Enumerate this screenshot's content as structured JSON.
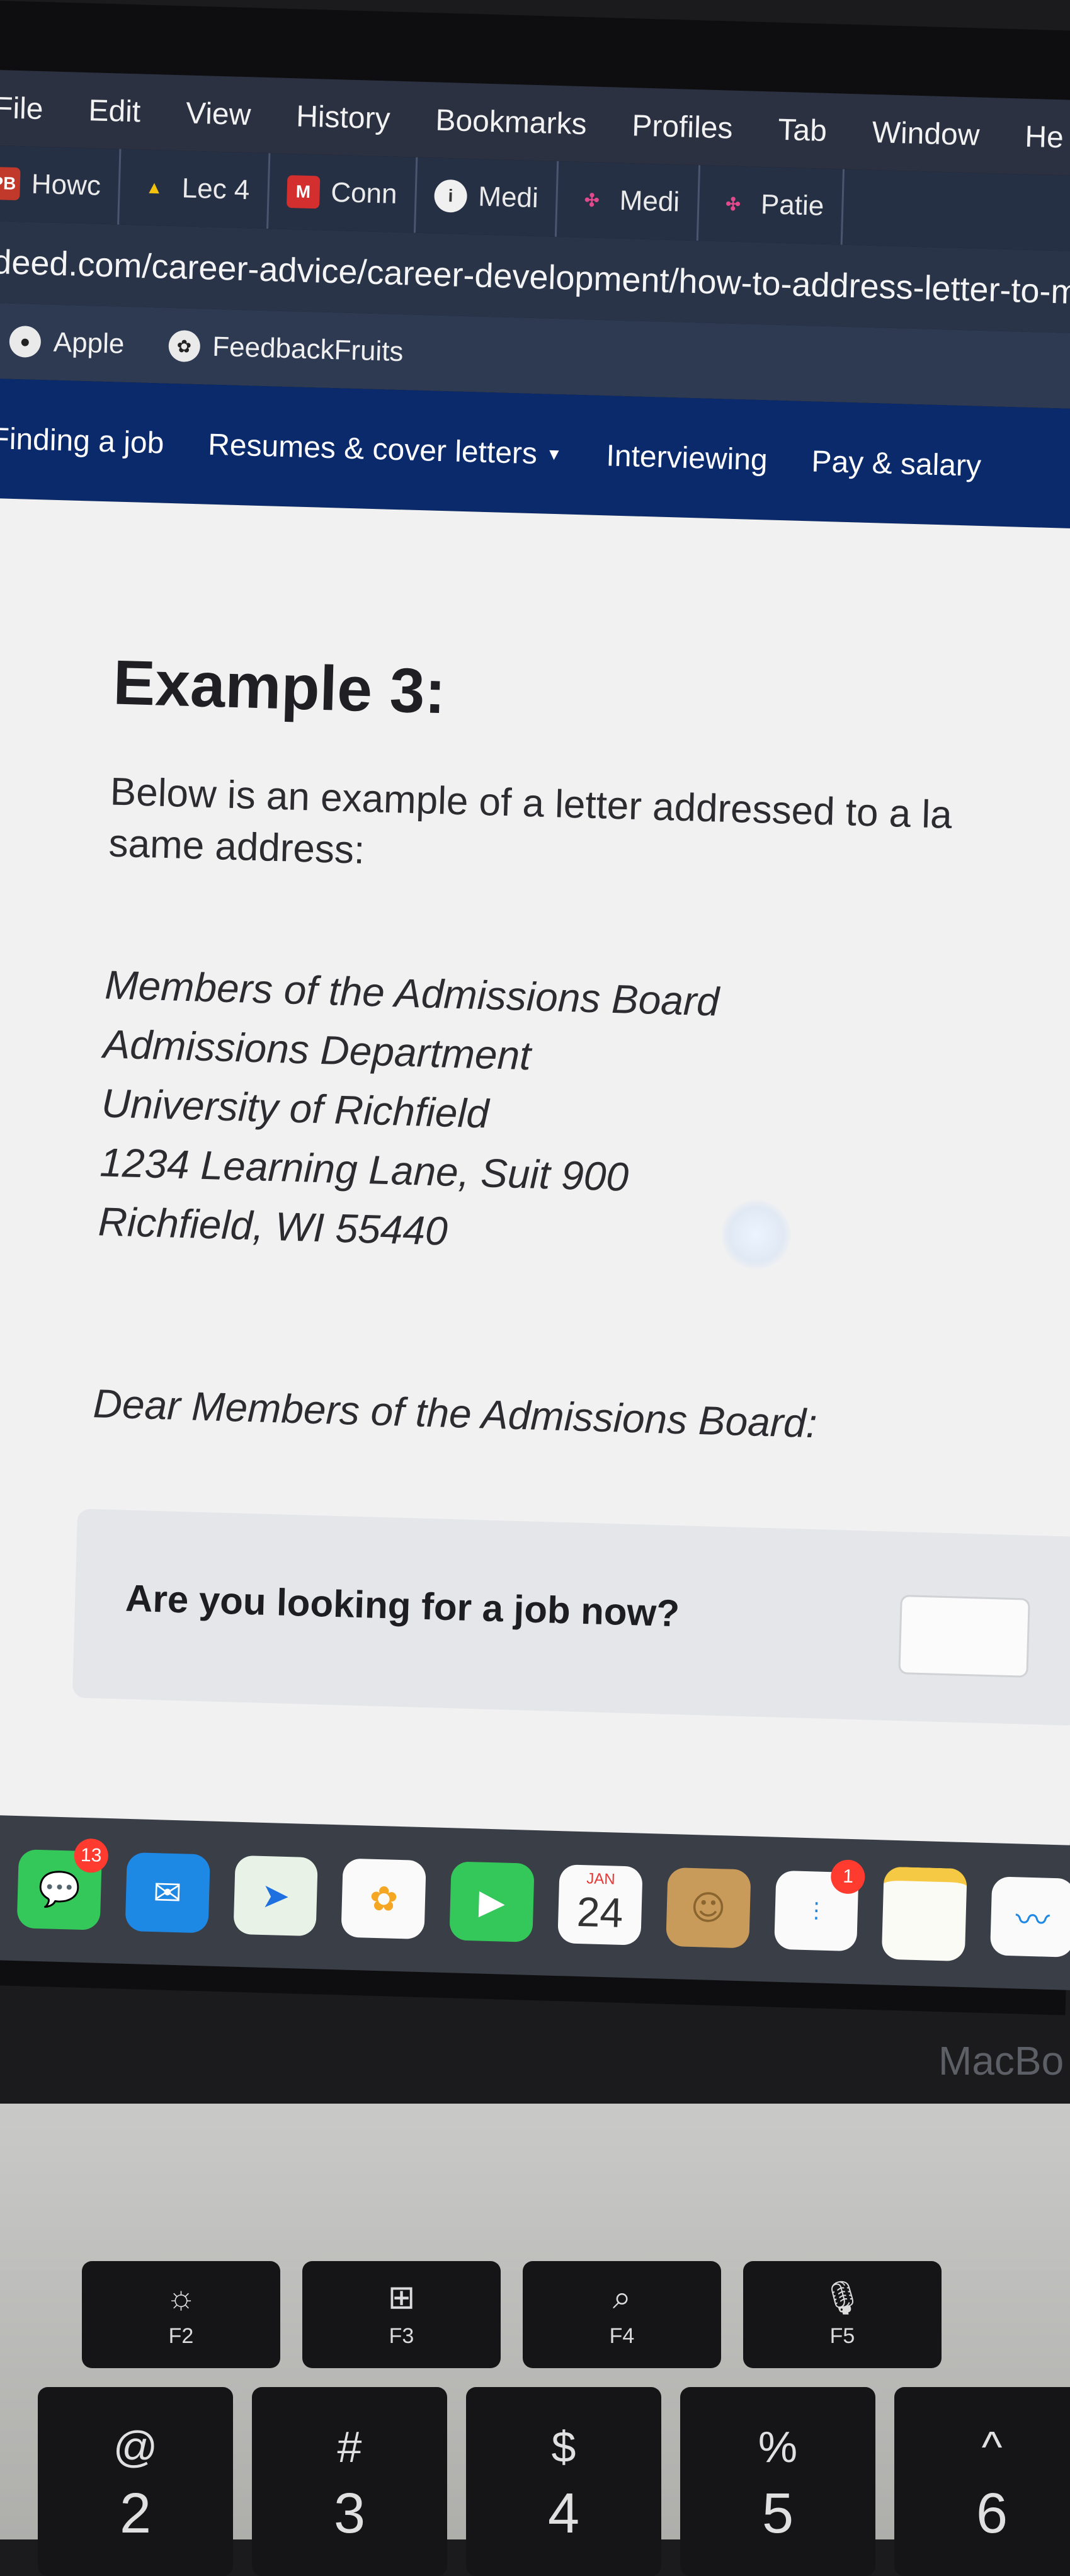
{
  "menubar": {
    "items": [
      "File",
      "Edit",
      "View",
      "History",
      "Bookmarks",
      "Profiles",
      "Tab",
      "Window",
      "He"
    ]
  },
  "tabs": [
    {
      "icon_text": "PB",
      "label": "Howc",
      "icon": "pb-icon",
      "color": "#c0392b"
    },
    {
      "icon_text": "▲",
      "label": "Lec 4",
      "icon": "google-drive-icon",
      "color": "#2b3140"
    },
    {
      "icon_text": "M",
      "label": "Conn",
      "icon": "m-logo-icon",
      "color": "#d32f2f"
    },
    {
      "icon_text": "i",
      "label": "Medi",
      "icon": "info-icon",
      "color": "#2b3140"
    },
    {
      "icon_text": "✣",
      "label": "Medi",
      "icon": "medical-star-icon",
      "color": "#2b3140"
    },
    {
      "icon_text": "✣",
      "label": "Patie",
      "icon": "medical-star-icon",
      "color": "#2b3140"
    }
  ],
  "url": "ndeed.com/career-advice/career-development/how-to-address-letter-to-m",
  "bookmarks": [
    {
      "label": "Apple",
      "icon": "apple-icon"
    },
    {
      "label": "FeedbackFruits",
      "icon": "feedbackfruits-icon"
    }
  ],
  "site_nav": {
    "finding_job": "Finding a job",
    "resumes": "Resumes & cover letters",
    "interviewing": "Interviewing",
    "pay": "Pay & salary"
  },
  "article": {
    "title": "Example 3:",
    "intro": "Below is an example of a letter addressed to a la same address:",
    "address_lines": [
      "Members of the Admissions Board",
      "Admissions Department",
      "University of Richfield",
      "1234 Learning Lane, Suit 900",
      "Richfield, WI 55440"
    ],
    "salutation": "Dear Members of the Admissions Board:"
  },
  "job_prompt": {
    "question": "Are you looking for a job now?"
  },
  "dock": {
    "messages_badge": "13",
    "reminders_badge": "1",
    "calendar_month": "JAN",
    "calendar_day": "24"
  },
  "device_label": "MacBo",
  "keyboard": {
    "fkeys": [
      {
        "glyph": "☼",
        "label": "F2"
      },
      {
        "glyph": "⊞",
        "label": "F3"
      },
      {
        "glyph": "⌕",
        "label": "F4"
      },
      {
        "glyph": "🎙",
        "label": "F5"
      }
    ],
    "number_keys": [
      {
        "sym": "@",
        "num": "2"
      },
      {
        "sym": "#",
        "num": "3"
      },
      {
        "sym": "$",
        "num": "4"
      },
      {
        "sym": "%",
        "num": "5"
      },
      {
        "sym": "^",
        "num": "6"
      }
    ]
  },
  "colors": {
    "site_nav_bg": "#0b2a6b",
    "content_bg": "#f1f1f1",
    "text": "#2b2b30"
  }
}
